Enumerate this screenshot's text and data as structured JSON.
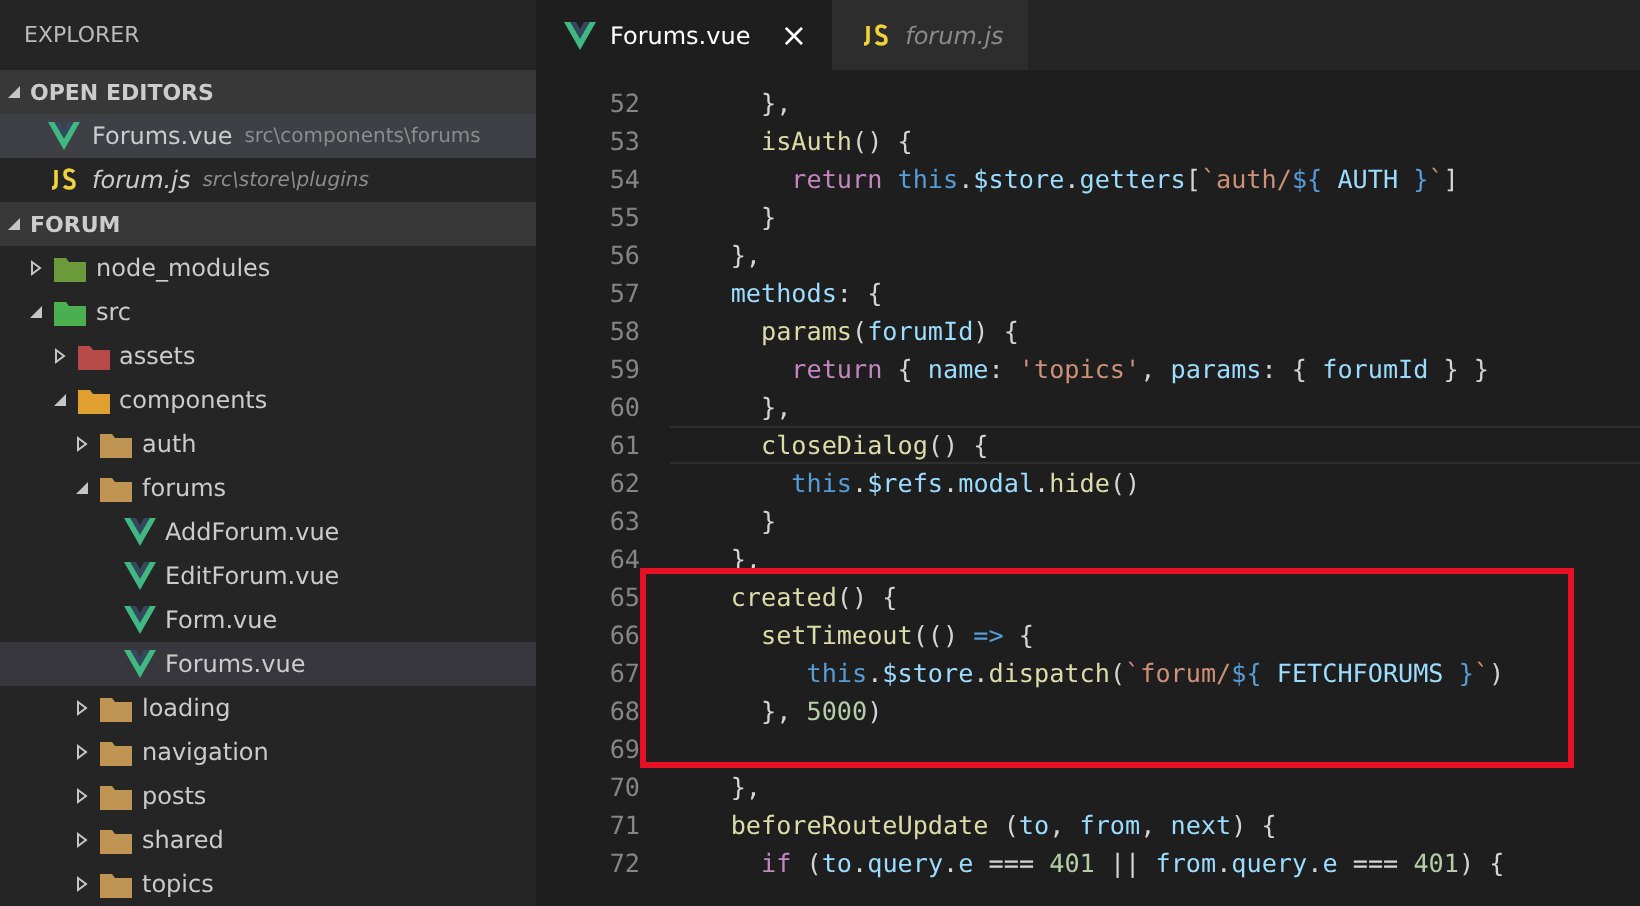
{
  "sidebar": {
    "title": "EXPLORER",
    "open_editors": {
      "title": "OPEN EDITORS",
      "expanded": true,
      "items": [
        {
          "name": "Forums.vue",
          "path": "src\\components\\forums",
          "kind": "vue",
          "selected": true,
          "preview": false
        },
        {
          "name": "forum.js",
          "path": "src\\store\\plugins",
          "kind": "js",
          "selected": false,
          "preview": true
        }
      ]
    },
    "folder": {
      "title": "FORUM",
      "expanded": true,
      "tree": [
        {
          "label": "node_modules",
          "kind": "node",
          "expanded": false,
          "selected": false
        },
        {
          "label": "src",
          "kind": "src",
          "expanded": true,
          "selected": false,
          "children": [
            {
              "label": "assets",
              "kind": "assets",
              "expanded": false,
              "selected": false
            },
            {
              "label": "components",
              "kind": "components",
              "expanded": true,
              "selected": false,
              "children": [
                {
                  "label": "auth",
                  "kind": "folder",
                  "expanded": false,
                  "selected": false
                },
                {
                  "label": "forums",
                  "kind": "folder",
                  "expanded": true,
                  "selected": false,
                  "children": [
                    {
                      "label": "AddForum.vue",
                      "kind": "vue",
                      "selected": false
                    },
                    {
                      "label": "EditForum.vue",
                      "kind": "vue",
                      "selected": false
                    },
                    {
                      "label": "Form.vue",
                      "kind": "vue",
                      "selected": false
                    },
                    {
                      "label": "Forums.vue",
                      "kind": "vue",
                      "selected": true
                    }
                  ]
                },
                {
                  "label": "loading",
                  "kind": "folder",
                  "expanded": false,
                  "selected": false
                },
                {
                  "label": "navigation",
                  "kind": "folder",
                  "expanded": false,
                  "selected": false
                },
                {
                  "label": "posts",
                  "kind": "folder",
                  "expanded": false,
                  "selected": false
                },
                {
                  "label": "shared",
                  "kind": "folder",
                  "expanded": false,
                  "selected": false
                },
                {
                  "label": "topics",
                  "kind": "folder",
                  "expanded": false,
                  "selected": false
                }
              ]
            }
          ]
        }
      ]
    }
  },
  "tabs": [
    {
      "label": "Forums.vue",
      "kind": "vue",
      "selected": true,
      "preview": false,
      "close": "×"
    },
    {
      "label": "forum.js",
      "kind": "js",
      "selected": false,
      "preview": true
    }
  ],
  "code": [
    {
      "number": "52",
      "boxed": false,
      "current": false,
      "tokens": [
        {
          "t": "      },",
          "kind": "plain"
        }
      ]
    },
    {
      "number": "53",
      "boxed": false,
      "current": false,
      "tokens": [
        {
          "t": "      isAuth",
          "kind": "func"
        },
        {
          "t": "() {",
          "kind": "plain"
        }
      ]
    },
    {
      "number": "54",
      "boxed": false,
      "current": false,
      "tokens": [
        {
          "t": "        return ",
          "kind": "keyword"
        },
        {
          "t": "this",
          "kind": "this"
        },
        {
          "t": ".",
          "kind": "plain"
        },
        {
          "t": "$store",
          "kind": "var"
        },
        {
          "t": ".",
          "kind": "plain"
        },
        {
          "t": "getters",
          "kind": "var"
        },
        {
          "t": "[",
          "kind": "plain"
        },
        {
          "t": "`auth/",
          "kind": "string"
        },
        {
          "t": "${",
          "kind": "this"
        },
        {
          "t": " AUTH ",
          "kind": "var"
        },
        {
          "t": "}",
          "kind": "this"
        },
        {
          "t": "`",
          "kind": "string"
        },
        {
          "t": "]",
          "kind": "plain"
        }
      ]
    },
    {
      "number": "55",
      "boxed": false,
      "current": false,
      "tokens": [
        {
          "t": "      }",
          "kind": "plain"
        }
      ]
    },
    {
      "number": "56",
      "boxed": false,
      "current": false,
      "tokens": [
        {
          "t": "    },",
          "kind": "plain"
        }
      ]
    },
    {
      "number": "57",
      "boxed": false,
      "current": false,
      "tokens": [
        {
          "t": "    methods",
          "kind": "var"
        },
        {
          "t": ": {",
          "kind": "plain"
        }
      ]
    },
    {
      "number": "58",
      "boxed": false,
      "current": false,
      "tokens": [
        {
          "t": "      params",
          "kind": "func"
        },
        {
          "t": "(",
          "kind": "plain"
        },
        {
          "t": "forumId",
          "kind": "var"
        },
        {
          "t": ") {",
          "kind": "plain"
        }
      ]
    },
    {
      "number": "59",
      "boxed": false,
      "current": false,
      "tokens": [
        {
          "t": "        return",
          "kind": "keyword"
        },
        {
          "t": " { ",
          "kind": "plain"
        },
        {
          "t": "name",
          "kind": "var"
        },
        {
          "t": ": ",
          "kind": "plain"
        },
        {
          "t": "'topics'",
          "kind": "string"
        },
        {
          "t": ", ",
          "kind": "plain"
        },
        {
          "t": "params",
          "kind": "var"
        },
        {
          "t": ": { ",
          "kind": "plain"
        },
        {
          "t": "forumId",
          "kind": "var"
        },
        {
          "t": " } }",
          "kind": "plain"
        }
      ]
    },
    {
      "number": "60",
      "boxed": false,
      "current": false,
      "tokens": [
        {
          "t": "      },",
          "kind": "plain"
        }
      ]
    },
    {
      "number": "61",
      "boxed": false,
      "current": true,
      "tokens": [
        {
          "t": "      closeDialog",
          "kind": "func"
        },
        {
          "t": "() {",
          "kind": "plain"
        }
      ]
    },
    {
      "number": "62",
      "boxed": false,
      "current": false,
      "tokens": [
        {
          "t": "        this",
          "kind": "this"
        },
        {
          "t": ".",
          "kind": "plain"
        },
        {
          "t": "$refs",
          "kind": "var"
        },
        {
          "t": ".",
          "kind": "plain"
        },
        {
          "t": "modal",
          "kind": "var"
        },
        {
          "t": ".",
          "kind": "plain"
        },
        {
          "t": "hide",
          "kind": "func"
        },
        {
          "t": "()",
          "kind": "plain"
        }
      ]
    },
    {
      "number": "63",
      "boxed": false,
      "current": false,
      "tokens": [
        {
          "t": "      }",
          "kind": "plain"
        }
      ]
    },
    {
      "number": "64",
      "boxed": false,
      "current": false,
      "tokens": [
        {
          "t": "    },",
          "kind": "plain"
        }
      ]
    },
    {
      "number": "65",
      "boxed": true,
      "current": false,
      "tokens": [
        {
          "t": "    created",
          "kind": "func"
        },
        {
          "t": "() {",
          "kind": "plain"
        }
      ]
    },
    {
      "number": "66",
      "boxed": true,
      "current": false,
      "tokens": [
        {
          "t": "      setTimeout",
          "kind": "func"
        },
        {
          "t": "(() ",
          "kind": "plain"
        },
        {
          "t": "=>",
          "kind": "this"
        },
        {
          "t": " {",
          "kind": "plain"
        }
      ]
    },
    {
      "number": "67",
      "boxed": true,
      "current": false,
      "tokens": [
        {
          "t": "         this",
          "kind": "this"
        },
        {
          "t": ".",
          "kind": "plain"
        },
        {
          "t": "$store",
          "kind": "var"
        },
        {
          "t": ".",
          "kind": "plain"
        },
        {
          "t": "dispatch",
          "kind": "func"
        },
        {
          "t": "(",
          "kind": "plain"
        },
        {
          "t": "`forum/",
          "kind": "string"
        },
        {
          "t": "${",
          "kind": "this"
        },
        {
          "t": " FETCHFORUMS ",
          "kind": "var"
        },
        {
          "t": "}",
          "kind": "this"
        },
        {
          "t": "`",
          "kind": "string"
        },
        {
          "t": ")",
          "kind": "plain"
        }
      ]
    },
    {
      "number": "68",
      "boxed": true,
      "current": false,
      "tokens": [
        {
          "t": "      }, ",
          "kind": "plain"
        },
        {
          "t": "5000",
          "kind": "number"
        },
        {
          "t": ")",
          "kind": "plain"
        }
      ]
    },
    {
      "number": "69",
      "boxed": true,
      "current": false
    },
    {
      "number": "70",
      "boxed": false,
      "current": false,
      "tokens": [
        {
          "t": "    },",
          "kind": "plain"
        }
      ]
    },
    {
      "number": "71",
      "boxed": false,
      "current": false,
      "tokens": [
        {
          "t": "    beforeRouteUpdate",
          "kind": "func"
        },
        {
          "t": " (",
          "kind": "plain"
        },
        {
          "t": "to",
          "kind": "var"
        },
        {
          "t": ", ",
          "kind": "plain"
        },
        {
          "t": "from",
          "kind": "var"
        },
        {
          "t": ", ",
          "kind": "plain"
        },
        {
          "t": "next",
          "kind": "var"
        },
        {
          "t": ") {",
          "kind": "plain"
        }
      ]
    },
    {
      "number": "72",
      "boxed": false,
      "current": false,
      "tokens": [
        {
          "t": "      if",
          "kind": "keyword"
        },
        {
          "t": " (",
          "kind": "plain"
        },
        {
          "t": "to",
          "kind": "var"
        },
        {
          "t": ".",
          "kind": "plain"
        },
        {
          "t": "query",
          "kind": "var"
        },
        {
          "t": ".",
          "kind": "plain"
        },
        {
          "t": "e",
          "kind": "var"
        },
        {
          "t": " === ",
          "kind": "plain"
        },
        {
          "t": "401",
          "kind": "number"
        },
        {
          "t": " || ",
          "kind": "plain"
        },
        {
          "t": "from",
          "kind": "var"
        },
        {
          "t": ".",
          "kind": "plain"
        },
        {
          "t": "query",
          "kind": "var"
        },
        {
          "t": ".",
          "kind": "plain"
        },
        {
          "t": "e",
          "kind": "var"
        },
        {
          "t": " === ",
          "kind": "plain"
        },
        {
          "t": "401",
          "kind": "number"
        },
        {
          "t": ") {",
          "kind": "plain"
        }
      ]
    }
  ]
}
